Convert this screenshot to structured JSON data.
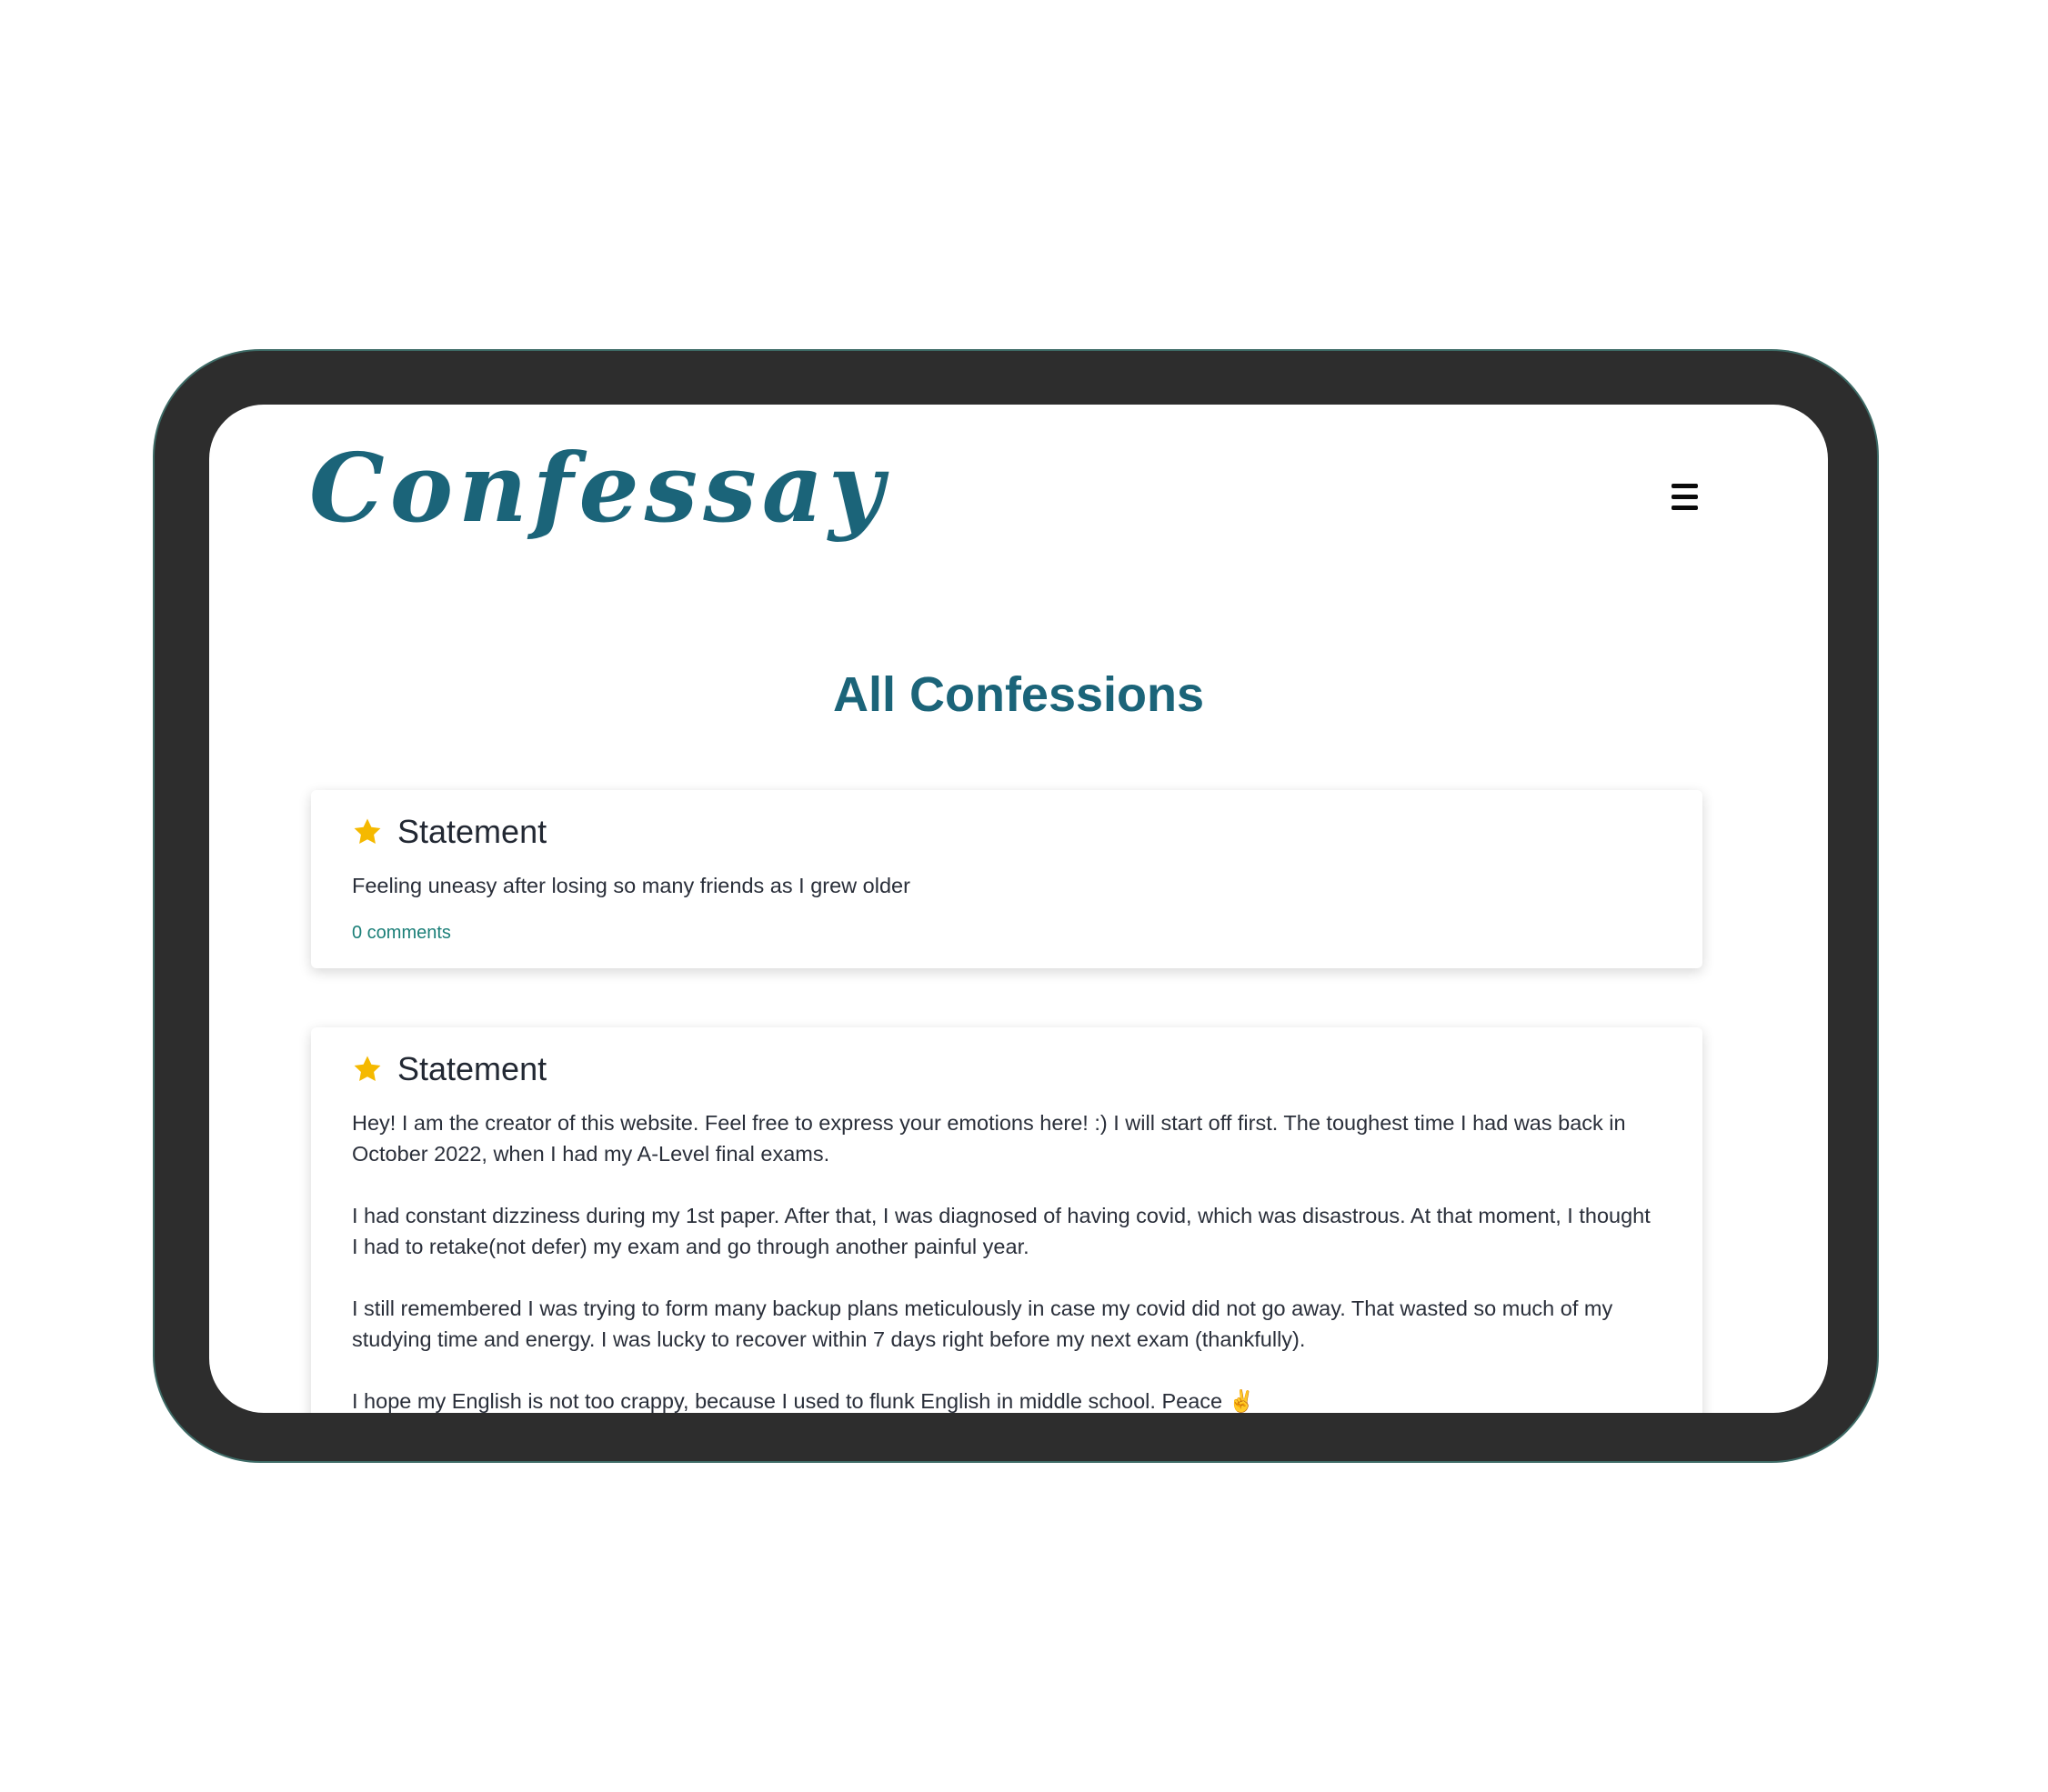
{
  "app": {
    "logo_text": "Confessay",
    "accent_color": "#1b6479",
    "link_color": "#1b7f78",
    "star_color": "#f5b900",
    "menu_icon": "hamburger-menu-icon"
  },
  "main": {
    "title": "All Confessions"
  },
  "confessions": [
    {
      "icon": "star-icon",
      "title": "Statement",
      "paragraphs": [
        "Feeling uneasy after losing so many friends as I grew older"
      ],
      "comments_label": "0 comments"
    },
    {
      "icon": "star-icon",
      "title": "Statement",
      "paragraphs": [
        "Hey! I am the creator of this website. Feel free to express your emotions here! :) I will start off first. The toughest time I had was back in October 2022, when I had my A-Level final exams.",
        "I had constant dizziness during my 1st paper. After that, I was diagnosed of having covid, which was disastrous. At that moment, I thought I had to retake(not defer) my exam and go through another painful year.",
        "I still remembered I was trying to form many backup plans meticulously in case my covid did not go away. That wasted so much of my studying time and energy. I was lucky to recover within 7 days right before my next exam (thankfully).",
        "I hope my English is not too crappy, because I used to flunk English in middle school. Peace ✌️"
      ]
    }
  ]
}
